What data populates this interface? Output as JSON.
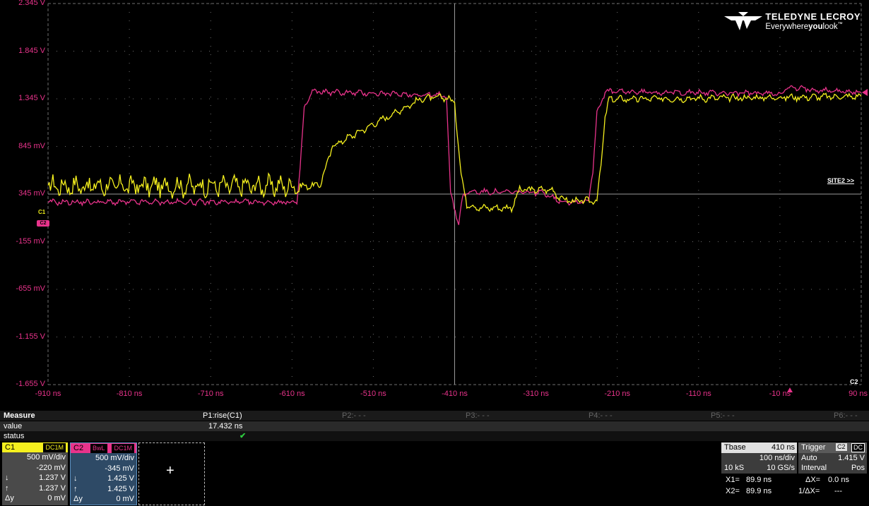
{
  "brand": {
    "name": "TELEDYNE LECROY",
    "tagline_pre": "Everywhere",
    "tagline_bold": "you",
    "tagline_post": "look",
    "tm": "™"
  },
  "y_axis_labels": [
    "2.345 V",
    "1.845 V",
    "1.345 V",
    "845 mV",
    "345 mV",
    "-155 mV",
    "-655 mV",
    "-1.155 V",
    "-1.655 V"
  ],
  "x_axis_labels": [
    "-910 ns",
    "-810 ns",
    "-710 ns",
    "-610 ns",
    "-510 ns",
    "-410 ns",
    "-310 ns",
    "-210 ns",
    "-110 ns",
    "-10 ns",
    "90 ns"
  ],
  "site_link": "SITE2 >>",
  "c2_tag": "C2",
  "c1_tag": "C1",
  "c2_marker": "C2",
  "colors": {
    "c1": "#f5f01e",
    "c2": "#e8338b",
    "grid": "#6e6e6e",
    "c1_box": "#f5f01e",
    "c2_box": "#e8338b"
  },
  "chart_data": {
    "type": "line",
    "x_unit": "ns",
    "y_unit": "V",
    "xlim": [
      -910,
      90
    ],
    "ylim": [
      -1.655,
      2.345
    ],
    "series": [
      {
        "name": "C1",
        "x": [
          -910,
          -600,
          -585,
          -575,
          -560,
          -450,
          -420,
          -410,
          -402,
          -395,
          -380,
          -340,
          -330,
          -290,
          -280,
          -265,
          -255,
          -235,
          -230,
          -225,
          -220,
          90
        ],
        "y": [
          0.43,
          0.43,
          0.43,
          0.45,
          0.85,
          1.35,
          1.36,
          1.3,
          0.55,
          0.24,
          0.2,
          0.2,
          0.39,
          0.39,
          0.3,
          0.27,
          0.27,
          0.28,
          0.65,
          1.15,
          1.34,
          1.37
        ]
      },
      {
        "name": "C2",
        "x": [
          -910,
          -604,
          -600,
          -595,
          -585,
          -420,
          -415,
          -405,
          -400,
          -390,
          -300,
          -280,
          -260,
          -245,
          -240,
          -235,
          -225,
          -10,
          0,
          90
        ],
        "y": [
          0.26,
          0.26,
          0.6,
          1.25,
          1.42,
          1.38,
          0.35,
          0.03,
          0.33,
          0.37,
          0.36,
          0.27,
          0.26,
          0.28,
          0.6,
          1.2,
          1.42,
          1.4,
          1.46,
          1.41
        ]
      }
    ]
  },
  "measure": {
    "title": "Measure",
    "p1": "P1:rise(C1)",
    "p2": "P2:- - -",
    "p3": "P3:- - -",
    "p4": "P4:- - -",
    "p5": "P5:- - -",
    "p6": "P6:- - -",
    "value_label": "value",
    "value": "17.432 ns",
    "status_label": "status",
    "status_icon": "✔"
  },
  "c1": {
    "label": "C1",
    "coupling": "DC1M",
    "vdiv": "500 mV/div",
    "offset": "-220 mV",
    "down_sym": "↓",
    "down_val": "1.237 V",
    "up_sym": "↑",
    "up_val": "1.237 V",
    "dy_sym": "Δy",
    "dy_val": "0 mV"
  },
  "c2": {
    "label": "C2",
    "bwl": "BwL",
    "coupling": "DC1M",
    "vdiv": "500 mV/div",
    "offset": "-345 mV",
    "down_sym": "↓",
    "down_val": "1.425 V",
    "up_sym": "↑",
    "up_val": "1.425 V",
    "dy_sym": "Δy",
    "dy_val": "0 mV"
  },
  "add_box": "+",
  "tbase": {
    "label": "Tbase",
    "value": "410 ns",
    "div": "100 ns/div",
    "samples": "10 kS",
    "rate": "10 GS/s"
  },
  "trigger": {
    "label": "Trigger",
    "src": "C2",
    "coupling": "DC",
    "mode": "Auto",
    "level": "1.415 V",
    "type": "Interval",
    "slope": "Pos"
  },
  "cursors": {
    "x1_label": "X1=",
    "x1": "89.9 ns",
    "dx_label": "ΔX=",
    "dx": "0.0 ns",
    "x2_label": "X2=",
    "x2": "89.9 ns",
    "inv_label": "1/ΔX=",
    "inv": "---"
  }
}
